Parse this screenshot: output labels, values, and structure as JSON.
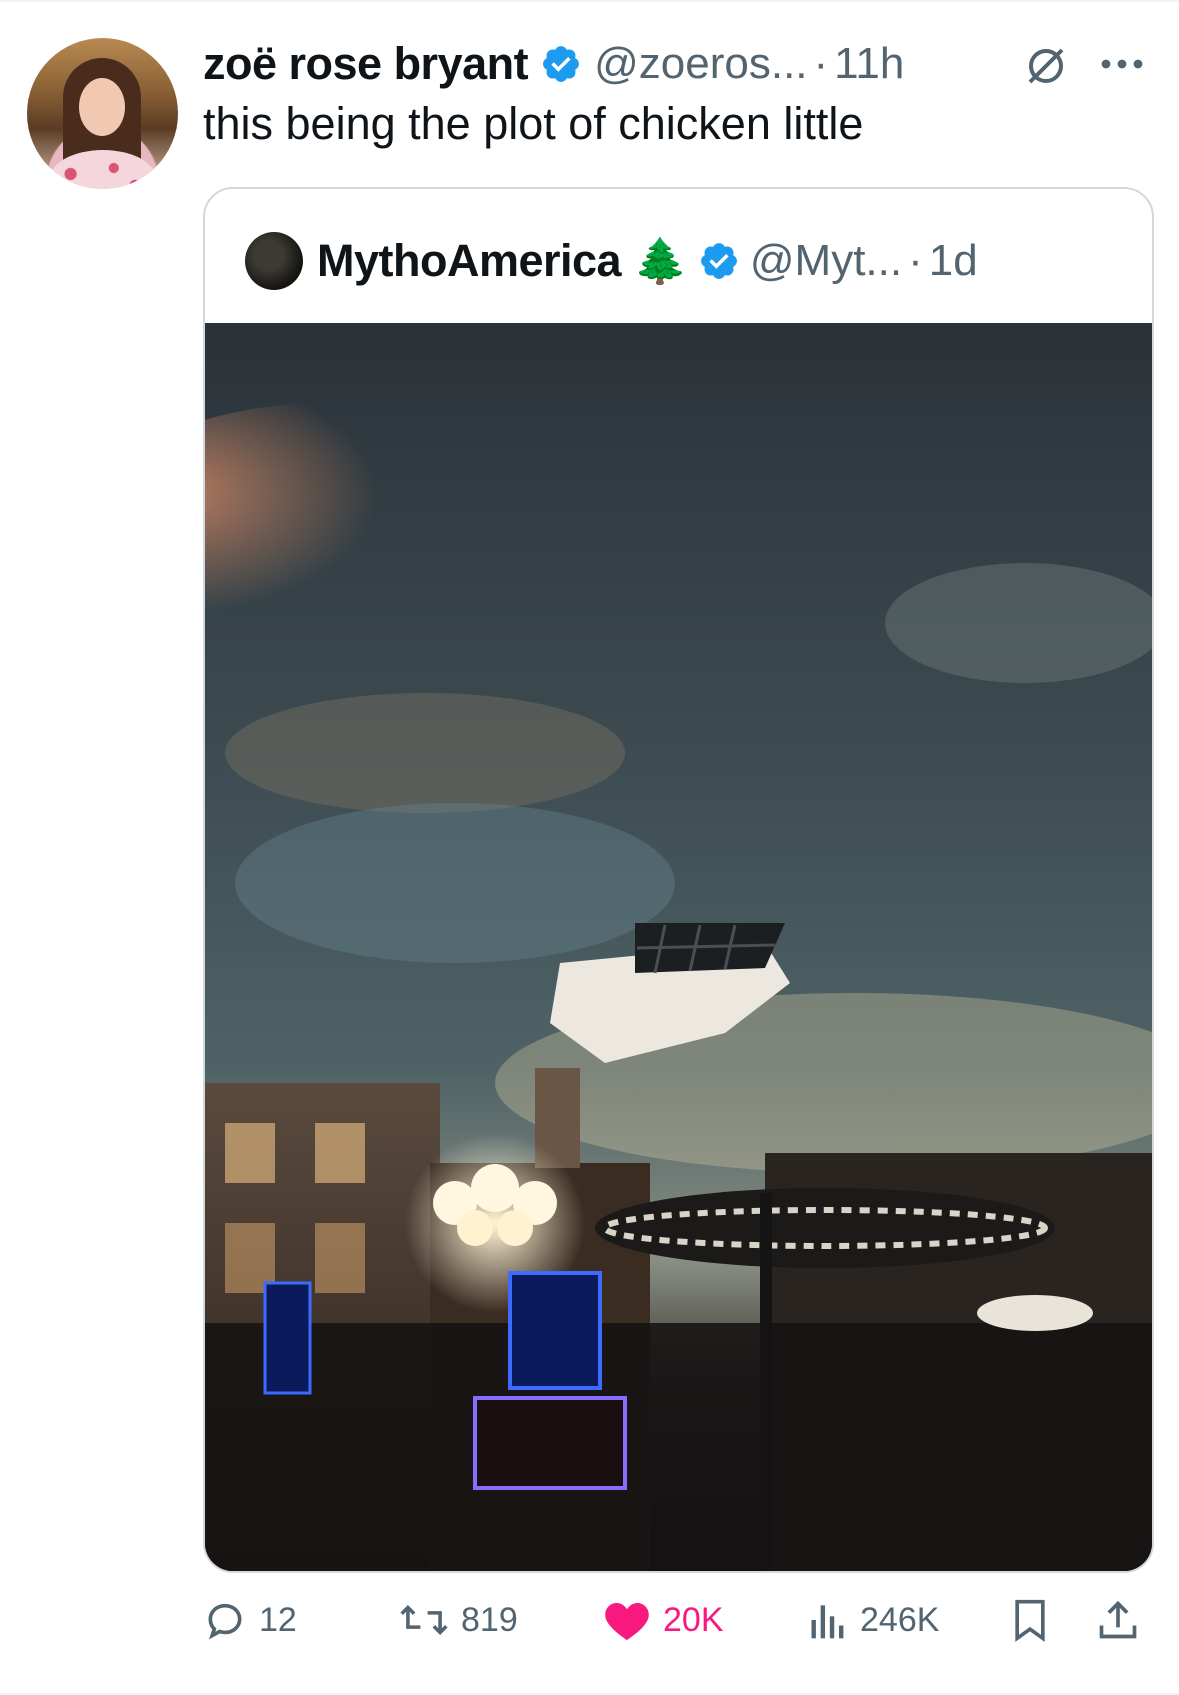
{
  "tweet": {
    "author_name": "zoë rose bryant",
    "handle": "@zoeros...",
    "separator": "·",
    "time": "11h",
    "text": "this being the plot of chicken little"
  },
  "quoted_tweet": {
    "author_name": "MythoAmerica",
    "emoji": "🌲",
    "handle": "@Myt...",
    "separator": "·",
    "time": "1d"
  },
  "actions": {
    "replies": "12",
    "reposts": "819",
    "likes": "20K",
    "views": "246K"
  },
  "colors": {
    "verified": "#1d9bf0",
    "like": "#f91880",
    "muted": "#536471"
  },
  "icons": [
    "verified-badge-icon",
    "grok-icon",
    "more-icon",
    "reply-icon",
    "repost-icon",
    "like-icon",
    "views-icon",
    "bookmark-icon",
    "share-icon"
  ]
}
